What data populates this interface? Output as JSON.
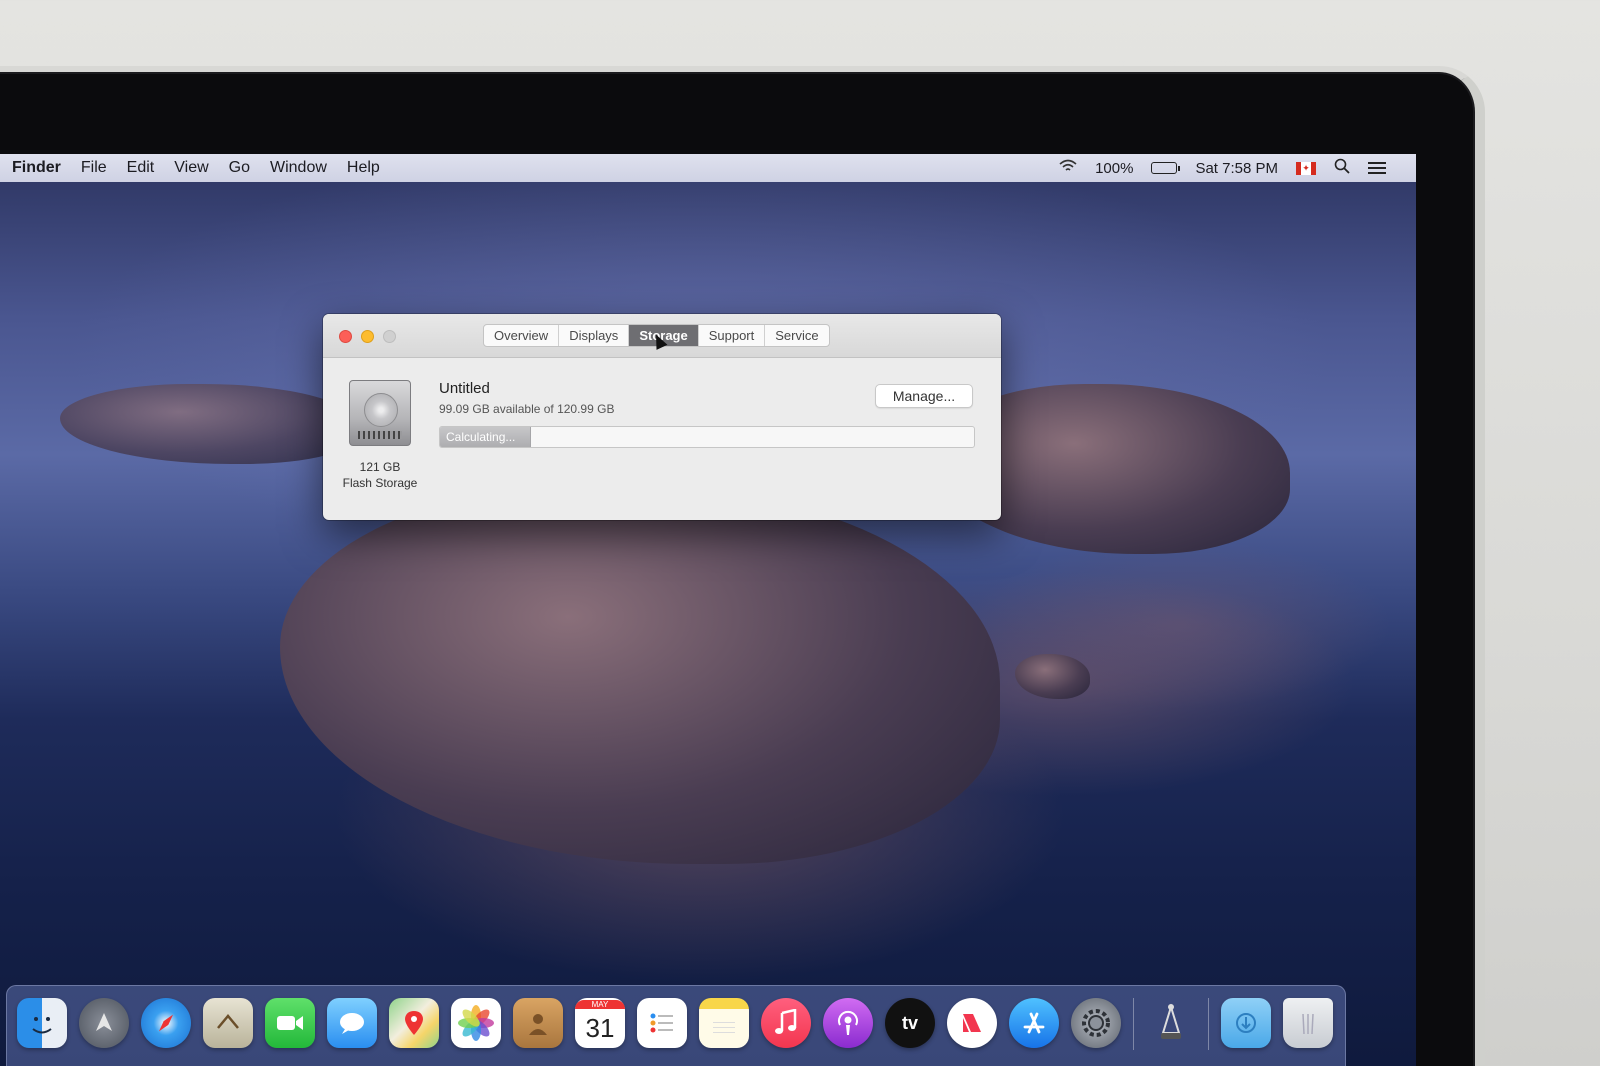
{
  "menubar": {
    "app": "Finder",
    "items": [
      "File",
      "Edit",
      "View",
      "Go",
      "Window",
      "Help"
    ],
    "battery": "100%",
    "clock": "Sat 7:58 PM"
  },
  "window": {
    "tabs": [
      "Overview",
      "Displays",
      "Storage",
      "Support",
      "Service"
    ],
    "active_tab": "Storage",
    "volume_name": "Untitled",
    "volume_available": "99.09 GB available of 120.99 GB",
    "disk_size": "121 GB",
    "disk_type": "Flash Storage",
    "manage_label": "Manage...",
    "storage_status": "Calculating..."
  },
  "dock": {
    "calendar_month": "MAY",
    "calendar_day": "31",
    "tv_label": "tv"
  },
  "colors": {
    "close": "#fc5f57",
    "minimize": "#fdbc2e",
    "maximize": "#d0d0d0",
    "active_tab": "#6e6e72"
  }
}
